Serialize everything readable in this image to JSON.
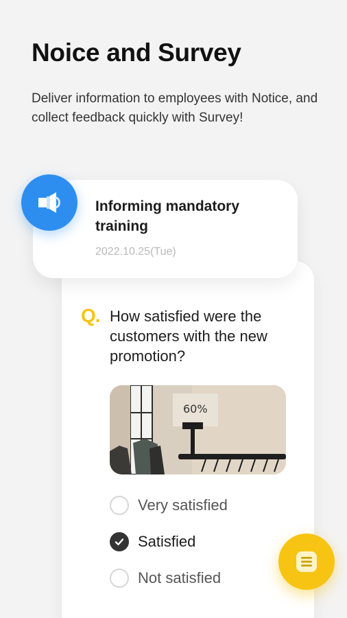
{
  "header": {
    "title": "Noice and Survey",
    "subtitle": "Deliver information to employees with Notice, and collect feedback quickly with Survey!"
  },
  "notice": {
    "icon": "megaphone-icon",
    "title": "Informing mandatory training",
    "date": "2022.10.25(Tue)"
  },
  "survey": {
    "q_mark": "Q.",
    "question": "How satisfied were the customers with the new promotion?",
    "photo_sign": "60%",
    "options": [
      {
        "label": "Very satisfied",
        "selected": false
      },
      {
        "label": "Satisfied",
        "selected": true
      },
      {
        "label": "Not satisfied",
        "selected": false
      }
    ]
  },
  "fab": {
    "icon": "list-note-icon"
  },
  "colors": {
    "accent_yellow": "#f7c413",
    "accent_blue": "#2d8ef0",
    "background": "#f3f3f3"
  }
}
